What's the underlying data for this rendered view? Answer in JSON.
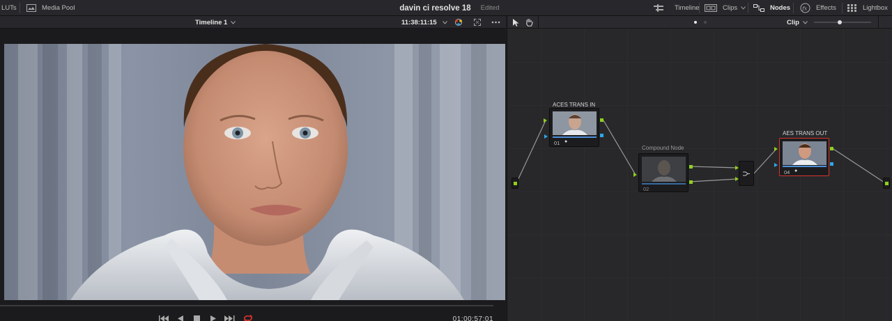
{
  "topbar": {
    "luts_label": "LUTs",
    "media_pool_label": "Media Pool",
    "app_title": "davin ci resolve 18",
    "status": "Edited",
    "timeline_label": "Timeline",
    "clips_label": "Clips",
    "nodes_label": "Nodes",
    "effects_label": "Effects",
    "lightbox_label": "Lightbox"
  },
  "viewer": {
    "timeline_name": "Timeline 1",
    "timecode": "11:38:11:15",
    "playhead_timecode": "01:00:57:01"
  },
  "node_editor": {
    "mode": "Clip",
    "nodes": [
      {
        "label": "ACES TRANS IN",
        "number": "01"
      },
      {
        "label": "Compound Node",
        "number": "02"
      },
      {
        "label": "AES TRANS OUT",
        "number": "04"
      }
    ]
  },
  "colors": {
    "accent_green": "#8fd11a",
    "accent_blue": "#2ea8e6",
    "selected_red": "#d8342c",
    "loop_red": "#e0352b"
  }
}
